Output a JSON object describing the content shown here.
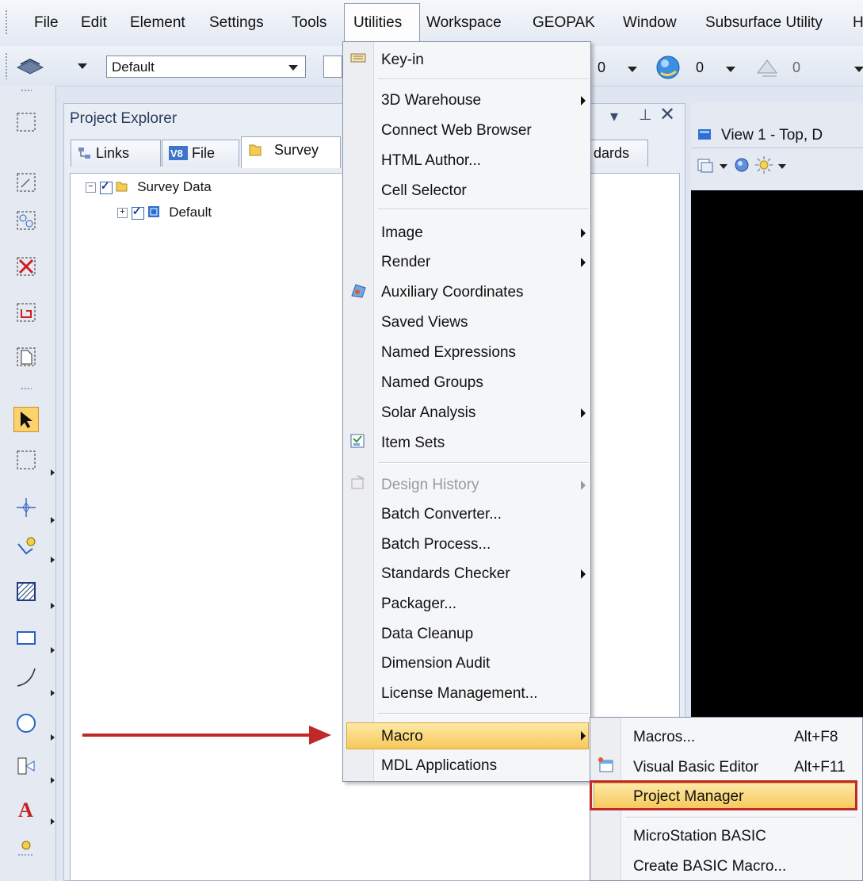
{
  "menubar": {
    "items": [
      "File",
      "Edit",
      "Element",
      "Settings",
      "Tools",
      "Utilities",
      "Workspace",
      "GEOPAK",
      "Window",
      "Subsurface Utility"
    ]
  },
  "toolbar": {
    "level_combo": "Default",
    "counts": [
      "0",
      "0",
      "0"
    ]
  },
  "project_explorer": {
    "title": "Project Explorer",
    "tabs": [
      "Links",
      "File",
      "Survey",
      "dards"
    ],
    "tree": {
      "root": "Survey Data",
      "child": "Default"
    }
  },
  "view": {
    "title": "View 1 - Top, D"
  },
  "utilities_menu": {
    "items": [
      {
        "label": "Key-in"
      },
      {
        "label": "3D Warehouse"
      },
      {
        "label": "Connect Web Browser"
      },
      {
        "label": "HTML Author..."
      },
      {
        "label": "Cell Selector"
      },
      {
        "label": "Image"
      },
      {
        "label": "Render"
      },
      {
        "label": "Auxiliary Coordinates"
      },
      {
        "label": "Saved Views"
      },
      {
        "label": "Named Expressions"
      },
      {
        "label": "Named Groups"
      },
      {
        "label": "Solar Analysis"
      },
      {
        "label": "Item Sets"
      },
      {
        "label": "Design History"
      },
      {
        "label": "Batch Converter..."
      },
      {
        "label": "Batch Process..."
      },
      {
        "label": "Standards Checker"
      },
      {
        "label": "Packager..."
      },
      {
        "label": "Data Cleanup"
      },
      {
        "label": "Dimension Audit"
      },
      {
        "label": "License Management..."
      },
      {
        "label": "Macro"
      },
      {
        "label": "MDL Applications"
      }
    ]
  },
  "macro_submenu": {
    "items": [
      {
        "label": "Macros...",
        "shortcut": "Alt+F8"
      },
      {
        "label": "Visual Basic Editor",
        "shortcut": "Alt+F11"
      },
      {
        "label": "Project Manager",
        "shortcut": ""
      },
      {
        "label": "MicroStation BASIC",
        "shortcut": ""
      },
      {
        "label": "Create BASIC Macro...",
        "shortcut": ""
      }
    ]
  },
  "colors": {
    "highlight": "#f7c95a",
    "annotation_arrow": "#c0282a",
    "annotation_box": "#c0282a"
  }
}
